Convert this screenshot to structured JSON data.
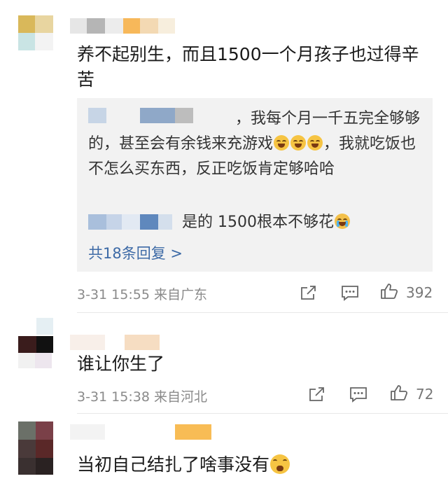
{
  "comments": [
    {
      "text": "养不起别生，而且1500一个月孩子也过得辛苦",
      "reply_box": {
        "reply1_text": "，我每个月一千五完全够够的，甚至会有余钱来充游戏",
        "reply1_tail": "，我就吃饭也不怎么买东西，反正吃饭肯定够哈哈",
        "reply1_emoji": "laughing-crying-emoji",
        "reply2_text": "是的 1500根本不够花",
        "reply2_emoji": "crying-emoji",
        "more_label": "共18条回复 >"
      },
      "meta": "3-31 15:55 来自广东",
      "likes": "392"
    },
    {
      "text": "谁让你生了",
      "meta": "3-31 15:38 来自河北",
      "likes": "72"
    },
    {
      "text": "当初自己结扎了啥事没有",
      "emoji": "fearful-face-emoji"
    }
  ],
  "icons": {
    "share": "share-icon",
    "comment": "comment-icon",
    "like": "thumbs-up-icon"
  },
  "colors": {
    "link": "#3d6aa6",
    "meta": "#8a8a8a",
    "reply_bg": "#f2f2f2"
  }
}
